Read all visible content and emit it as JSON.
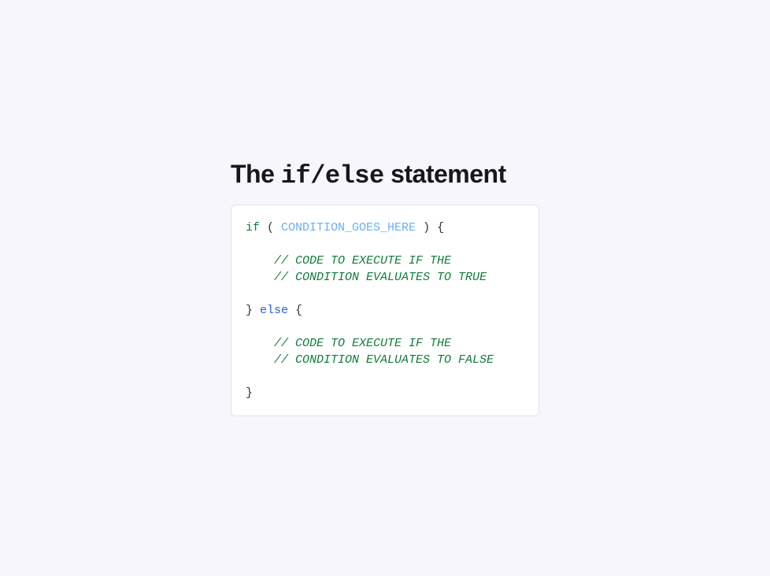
{
  "heading": {
    "prefix": "The ",
    "code_if": "if",
    "slash": "/",
    "code_else": "else",
    "suffix": " statement"
  },
  "code": {
    "line1_kw": "if",
    "line1_open": " ( ",
    "line1_placeholder": "CONDITION_GOES_HERE",
    "line1_close": " ) {",
    "blank": "",
    "line3_indent": "    ",
    "line3_comment": "// CODE TO EXECUTE IF THE",
    "line4_indent": "    ",
    "line4_comment": "// CONDITION EVALUATES TO TRUE",
    "line6_close": "} ",
    "line6_else": "else",
    "line6_open": " {",
    "line8_indent": "    ",
    "line8_comment": "// CODE TO EXECUTE IF THE",
    "line9_indent": "    ",
    "line9_comment": "// CONDITION EVALUATES TO FALSE",
    "line11_close": "}"
  }
}
